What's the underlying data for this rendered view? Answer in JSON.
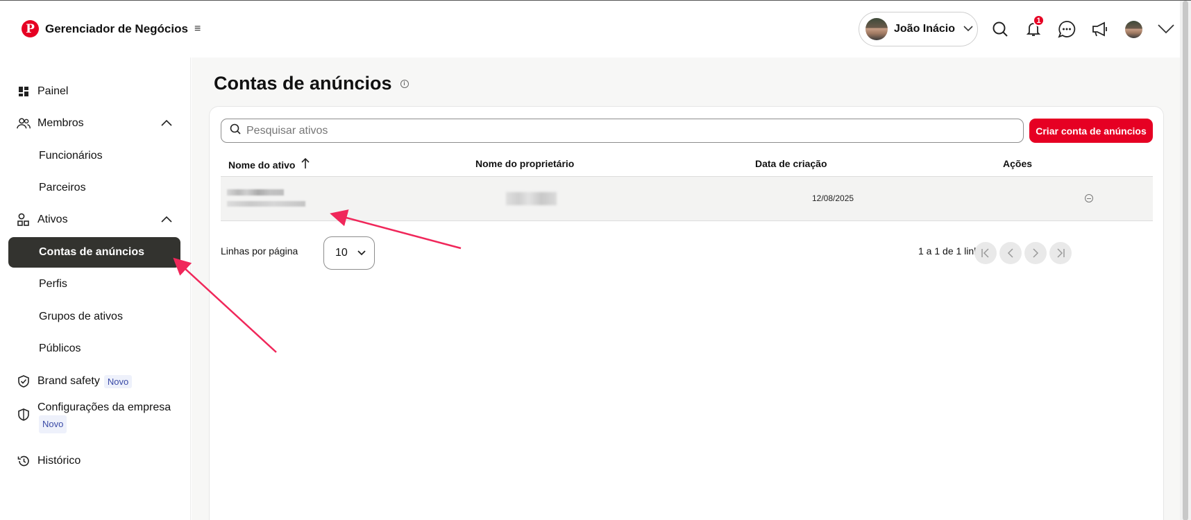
{
  "header": {
    "brand_title": "Gerenciador de Negócios",
    "user_name": "João Inácio",
    "notification_count": "1"
  },
  "sidebar": {
    "items": [
      {
        "label": "Painel"
      },
      {
        "label": "Membros"
      },
      {
        "label": "Funcionários"
      },
      {
        "label": "Parceiros"
      },
      {
        "label": "Ativos"
      },
      {
        "label": "Contas de anúncios"
      },
      {
        "label": "Perfis"
      },
      {
        "label": "Grupos de ativos"
      },
      {
        "label": "Públicos"
      },
      {
        "label": "Brand safety",
        "tag": "Novo"
      },
      {
        "label": "Configurações da empresa",
        "tag": "Novo"
      },
      {
        "label": "Histórico"
      }
    ]
  },
  "main": {
    "title": "Contas de anúncios",
    "search_placeholder": "Pesquisar ativos",
    "create_button": "Criar conta de anúncios",
    "columns": [
      "Nome do ativo",
      "Nome do proprietário",
      "Data de criação",
      "Ações"
    ],
    "rows": [
      {
        "date": "12/08/2025"
      }
    ],
    "rows_per_page_label": "Linhas por página",
    "rows_per_page_value": "10",
    "range_text": "1 a 1 de 1 linha"
  },
  "colors": {
    "brand_red": "#e60023",
    "active_nav": "#33332f",
    "annotation_arrow": "#f0275a"
  }
}
